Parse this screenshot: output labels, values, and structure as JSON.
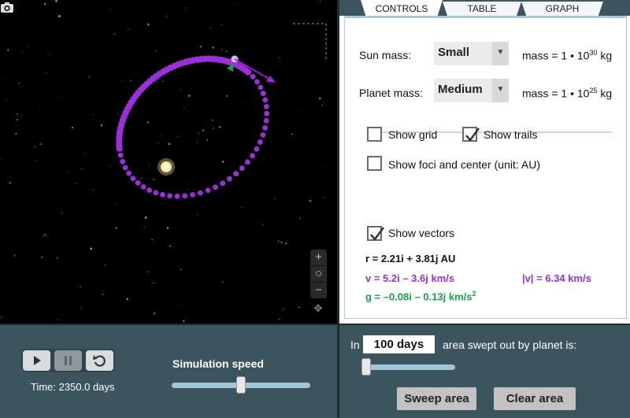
{
  "tabs": [
    {
      "label": "CONTROLS",
      "active": true
    },
    {
      "label": "TABLE",
      "active": false
    },
    {
      "label": "GRAPH",
      "active": false
    }
  ],
  "controls": {
    "sun_mass_label": "Sun mass:",
    "sun_mass_value": "Small",
    "sun_mass_text": "mass = 1 • 10",
    "sun_mass_exp": "30",
    "sun_mass_unit": " kg",
    "planet_mass_label": "Planet mass:",
    "planet_mass_value": "Medium",
    "planet_mass_text": "mass = 1 • 10",
    "planet_mass_exp": "25",
    "planet_mass_unit": " kg",
    "show_grid_label": "Show grid",
    "show_grid_checked": false,
    "show_trails_label": "Show trails",
    "show_trails_checked": true,
    "show_foci_label": "Show foci and center (unit: AU)",
    "show_foci_checked": false,
    "show_vectors_label": "Show vectors",
    "show_vectors_checked": true,
    "r_text": "r  = 2.21i + 3.81j AU",
    "v_text": "v = 5.2i – 3.6j km/s",
    "v_mag_text": "|v| = 6.34 km/s",
    "g_text": "g = –0.08i – 0.13j km/s",
    "g_exp": "2"
  },
  "simulation": {
    "time_text": "Time: 2350.0 days",
    "speed_label": "Simulation speed",
    "speed_fraction": 0.5
  },
  "area": {
    "in_label": "In",
    "days_value": "100 days",
    "swept_label": "area swept out by planet is:",
    "days_slider_fraction": 0.03,
    "sweep_button": "Sweep area",
    "clear_button": "Clear area"
  },
  "icons": {
    "camera": "camera-icon",
    "zoom_in": "+",
    "zoom_reset": "○",
    "zoom_out": "−",
    "pan": "✥"
  },
  "colors": {
    "trail": "#9b30d9",
    "velocity": "#a020e0",
    "gravity": "#1aa04a",
    "sun": "#ffe680"
  }
}
